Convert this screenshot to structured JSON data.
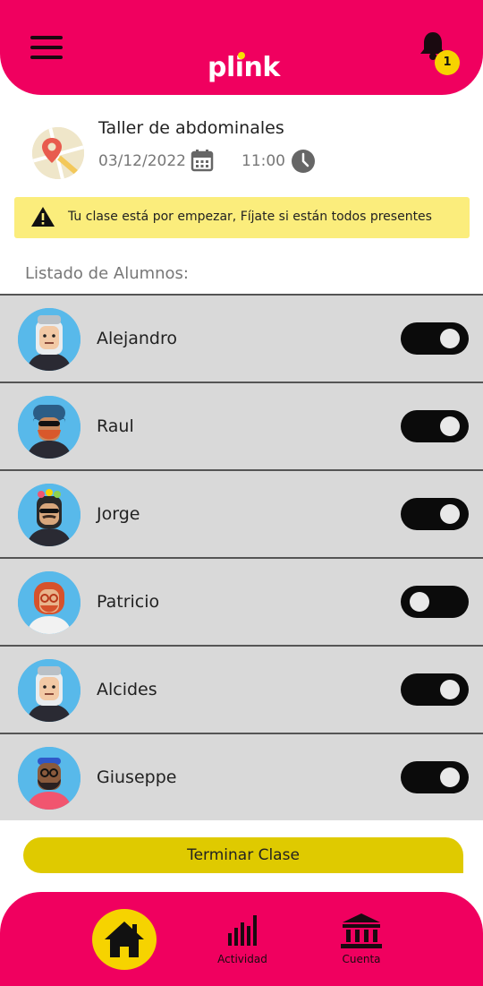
{
  "header": {
    "logo_text": "plink",
    "notification_count": "1"
  },
  "class_info": {
    "title": "Taller de abdominales",
    "date": "03/12/2022",
    "time": "11:00"
  },
  "alert": {
    "text": "Tu clase está por empezar, Fíjate si están todos presentes"
  },
  "list_label": "Listado de Alumnos:",
  "students": [
    {
      "name": "Alejandro",
      "present": true
    },
    {
      "name": "Raul",
      "present": true
    },
    {
      "name": "Jorge",
      "present": true
    },
    {
      "name": "Patricio",
      "present": false
    },
    {
      "name": "Alcides",
      "present": true
    },
    {
      "name": "Giuseppe",
      "present": true
    }
  ],
  "finish_button": "Terminar Clase",
  "bottom_nav": {
    "activity_label": "Actividad",
    "account_label": "Cuenta"
  },
  "colors": {
    "brand": "#f0005f",
    "accent": "#f6d300",
    "alert_bg": "#fbed7c",
    "row_bg": "#d9d9d9"
  }
}
